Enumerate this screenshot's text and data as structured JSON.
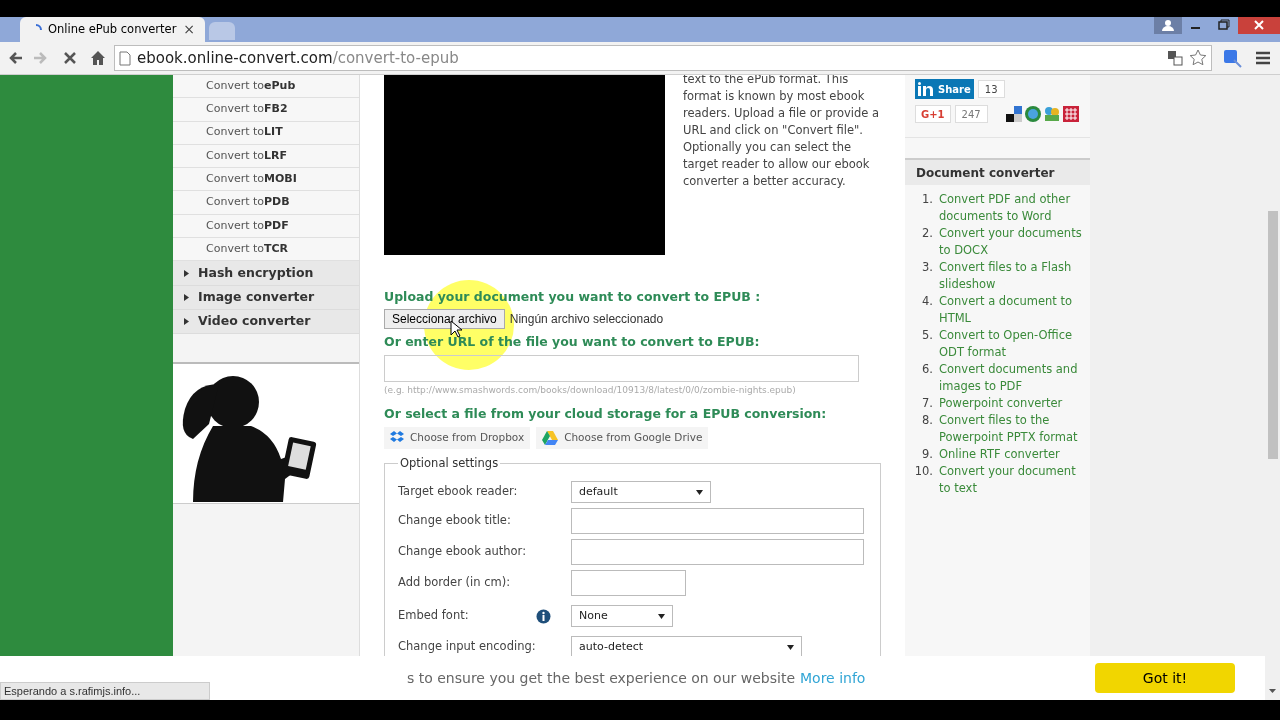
{
  "browser": {
    "tabs": [
      {
        "title": "Online ePub converter",
        "close": "×",
        "selected": true,
        "loading": true
      },
      {
        "selected": false
      }
    ],
    "url_host": "ebook.online-convert.com",
    "url_path": "/convert-to-epub",
    "loading": true
  },
  "left_nav": {
    "items": [
      {
        "kind": "sub",
        "prefix": "Convert to ",
        "format": "ePub"
      },
      {
        "kind": "sub",
        "prefix": "Convert to ",
        "format": "FB2"
      },
      {
        "kind": "sub",
        "prefix": "Convert to ",
        "format": "LIT"
      },
      {
        "kind": "sub",
        "prefix": "Convert to ",
        "format": "LRF"
      },
      {
        "kind": "sub",
        "prefix": "Convert to ",
        "format": "MOBI"
      },
      {
        "kind": "sub",
        "prefix": "Convert to ",
        "format": "PDB"
      },
      {
        "kind": "sub",
        "prefix": "Convert to ",
        "format": "PDF"
      },
      {
        "kind": "sub",
        "prefix": "Convert to ",
        "format": "TCR"
      },
      {
        "kind": "group",
        "label": "Hash encryption",
        "expanded": false
      },
      {
        "kind": "group",
        "label": "Image converter",
        "expanded": false
      },
      {
        "kind": "group",
        "label": "Video converter",
        "expanded": false
      }
    ]
  },
  "intro": "text to the ePub format. This format is known by most ebook readers. Upload a file or provide a URL and click on \"Convert file\". Optionally you can select the target reader to allow our ebook converter a better accuracy.",
  "upload": {
    "heading": "Upload your document you want to convert to EPUB :",
    "button": "Seleccionar archivo",
    "file_status": "Ningún archivo seleccionado"
  },
  "url": {
    "heading": "Or enter URL of the file you want to convert to EPUB:",
    "example": "(e.g. http://www.smashwords.com/books/download/10913/8/latest/0/0/zombie-nights.epub)"
  },
  "cloud": {
    "heading": "Or select a file from your cloud storage for a EPUB conversion:",
    "buttons": [
      {
        "kind": "dropbox",
        "label": "Choose from Dropbox"
      },
      {
        "kind": "drive",
        "label": "Choose from Google Drive"
      }
    ]
  },
  "settings": {
    "legend": "Optional settings",
    "rows": [
      {
        "kind": "select",
        "label": "Target ebook reader:",
        "value": "default"
      },
      {
        "kind": "text",
        "label": "Change ebook title:"
      },
      {
        "kind": "text",
        "label": "Change ebook author:"
      },
      {
        "kind": "text",
        "label": "Add border (in cm):"
      },
      {
        "kind": "select",
        "label": "Embed font:",
        "value": "None",
        "info": true
      },
      {
        "kind": "select",
        "label": "Change input encoding:",
        "value": "auto-detect"
      }
    ]
  },
  "share": {
    "linkedin": {
      "label": "Share",
      "count": "13"
    },
    "gplus": {
      "label": "G+1",
      "count": "247"
    }
  },
  "doc_converter": {
    "title": "Document converter",
    "items": [
      {
        "number": "1.",
        "text": "Convert PDF and other documents to Word"
      },
      {
        "number": "2.",
        "text": "Convert your documents to DOCX"
      },
      {
        "number": "3.",
        "text": "Convert files to a Flash slideshow"
      },
      {
        "number": "4.",
        "text": "Convert a document to HTML"
      },
      {
        "number": "5.",
        "text": "Convert to Open-Office ODT format"
      },
      {
        "number": "6.",
        "text": "Convert documents and images to PDF"
      },
      {
        "number": "7.",
        "text": "Powerpoint converter"
      },
      {
        "number": "8.",
        "text": "Convert files to the Powerpoint PPTX format"
      },
      {
        "number": "9.",
        "text": "Online RTF converter"
      },
      {
        "number": "10.",
        "text": "Convert your document to text"
      }
    ]
  },
  "cookie": {
    "text": "s to ensure you get the best experience on our website",
    "link": "More info",
    "button": "Got it!"
  },
  "status_bar": "Esperando a s.rafimjs.info..."
}
